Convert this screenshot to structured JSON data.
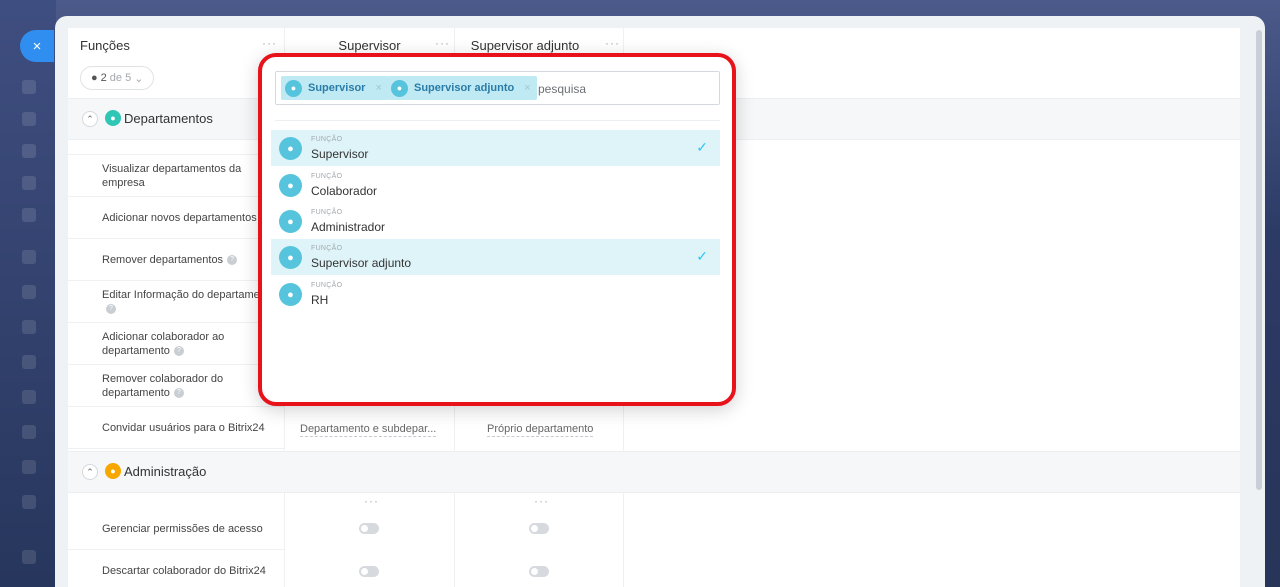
{
  "close_icon": "×",
  "roles_header": {
    "title": "Funções",
    "counter_current": "2",
    "counter_separator": "de 5",
    "dots": "···"
  },
  "columns": [
    {
      "label": "Supervisor",
      "dots": "···"
    },
    {
      "label": "Supervisor adjunto",
      "dots": "···"
    }
  ],
  "sections": [
    {
      "label": "Departamentos",
      "icon": "group-icon",
      "color": "#2fc6b5",
      "permissions": [
        {
          "label": "Visualizar departamentos da empresa",
          "help": false
        },
        {
          "label": "Adicionar novos departamentos",
          "help": true
        },
        {
          "label": "Remover departamentos",
          "help": true
        },
        {
          "label": "Editar Informação do departamento",
          "help": true
        },
        {
          "label": "Adicionar colaborador ao departamento",
          "help": true
        },
        {
          "label": "Remover colaborador do departamento",
          "help": true
        },
        {
          "label": "Convidar usuários para o Bitrix24",
          "help": false
        }
      ],
      "invite_values": [
        "Departamento e subdepar...",
        "Próprio departamento"
      ]
    },
    {
      "label": "Administração",
      "icon": "person-icon",
      "color": "#f7a700",
      "dots": "···",
      "permissions": [
        {
          "label": "Gerenciar permissões de acesso"
        },
        {
          "label": "Descartar colaborador do Bitrix24"
        }
      ]
    }
  ],
  "popup": {
    "tags": [
      "Supervisor",
      "Supervisor adjunto"
    ],
    "tag_close": "×",
    "search_placeholder": "pesquisa",
    "items": [
      {
        "kind": "FUNÇÃO",
        "name": "Supervisor",
        "selected": true
      },
      {
        "kind": "FUNÇÃO",
        "name": "Colaborador",
        "selected": false
      },
      {
        "kind": "FUNÇÃO",
        "name": "Administrador",
        "selected": false
      },
      {
        "kind": "FUNÇÃO",
        "name": "Supervisor adjunto",
        "selected": true
      },
      {
        "kind": "FUNÇÃO",
        "name": "RH",
        "selected": false
      }
    ],
    "check_mark": "✓"
  }
}
